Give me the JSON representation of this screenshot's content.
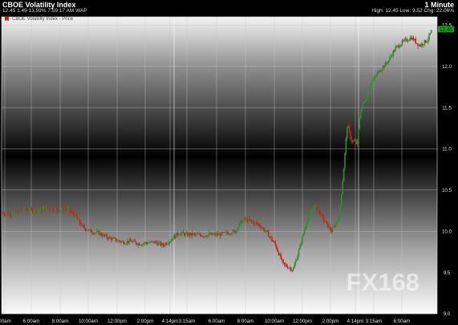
{
  "header": {
    "title": "CBOE Volatility Index",
    "interval": "1 Minute",
    "quote": "12.45 1.49 13.59% 7:59:17 AM WAP",
    "stats": "High: 12.45 Low: 9.52 Chg: 22.06%"
  },
  "legend": {
    "label": "CBOE Volatility Index - Price"
  },
  "last_price_label": "12.45",
  "watermark": "FX168",
  "colors": {
    "up": "#2f8f2f",
    "down": "#cc1f1f",
    "grid": "#c8c8c8",
    "last_price_bg": "#14a014"
  },
  "chart_data": {
    "type": "candlestick",
    "title": "CBOE Volatility Index",
    "interval": "1 Minute",
    "series": [
      {
        "name": "CBOE Volatility Index - Price",
        "x": [
          0,
          10,
          20,
          30,
          40,
          50,
          60,
          70,
          80,
          90,
          100,
          110,
          120,
          130,
          140,
          150,
          160,
          170,
          180,
          190,
          200,
          210,
          220,
          230,
          240,
          250,
          260,
          270,
          280,
          290,
          300,
          310,
          320,
          330,
          340,
          350,
          360,
          362,
          370,
          380,
          390,
          400,
          410,
          420,
          425,
          430,
          435,
          440,
          442,
          446,
          450,
          455,
          460,
          470,
          480,
          490,
          500,
          510,
          520,
          530,
          536
        ],
        "close": [
          10.22,
          10.21,
          10.24,
          10.26,
          10.25,
          10.27,
          10.28,
          10.26,
          10.27,
          10.2,
          10.05,
          10.0,
          9.98,
          9.93,
          9.9,
          9.87,
          9.88,
          9.85,
          9.86,
          9.87,
          9.83,
          9.9,
          9.98,
          9.96,
          9.96,
          9.95,
          9.96,
          9.96,
          9.98,
          10.0,
          10.15,
          10.12,
          10.08,
          9.98,
          9.84,
          9.6,
          9.55,
          9.52,
          9.78,
          10.15,
          10.3,
          10.15,
          10.0,
          10.18,
          10.7,
          11.3,
          11.1,
          11.08,
          11.05,
          11.45,
          11.55,
          11.65,
          11.8,
          11.95,
          12.05,
          12.22,
          12.3,
          12.35,
          12.25,
          12.32,
          12.45
        ]
      }
    ],
    "x_tick_labels": [
      "00am",
      "6:00am",
      "8:00am",
      "10:00am",
      "12:00pm",
      "2:00pm",
      "4:14pm",
      "3:15am",
      "6:00am",
      "8:00am",
      "10:00am",
      "12:00pm",
      "2:00pm",
      "4:14pm",
      "3:15am",
      "6:00am"
    ],
    "y_ticks": [
      9.0,
      9.5,
      10.0,
      10.5,
      11.0,
      11.5,
      12.0,
      12.5
    ],
    "ylim": [
      9.0,
      12.6
    ],
    "high": 12.45,
    "low": 9.52,
    "grid": true,
    "y_axis_side": "right",
    "legend_position": "top-left"
  }
}
